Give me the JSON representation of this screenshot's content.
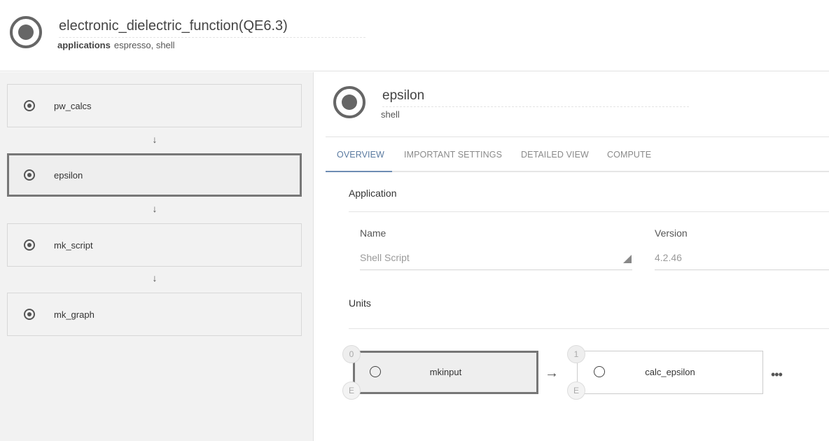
{
  "workflow": {
    "title": "electronic_dielectric_function(QE6.3)",
    "applications_label": "applications",
    "applications_value": "espresso, shell",
    "icon": "radio-filled-icon"
  },
  "sidebar": {
    "subworkflows": [
      {
        "label": "pw_calcs",
        "selected": false
      },
      {
        "label": "epsilon",
        "selected": true
      },
      {
        "label": "mk_script",
        "selected": false
      },
      {
        "label": "mk_graph",
        "selected": false
      }
    ],
    "arrow_glyph": "↓"
  },
  "unit": {
    "title": "epsilon",
    "subtitle": "shell"
  },
  "tabs": [
    {
      "label": "OVERVIEW",
      "active": true
    },
    {
      "label": "IMPORTANT SETTINGS",
      "active": false
    },
    {
      "label": "DETAILED VIEW",
      "active": false
    },
    {
      "label": "COMPUTE",
      "active": false
    }
  ],
  "application_section": {
    "title": "Application",
    "name_label": "Name",
    "name_value": "Shell Script",
    "version_label": "Version",
    "version_value": "4.2.46"
  },
  "units_section": {
    "title": "Units",
    "flow_arrow": "→",
    "more": "•••",
    "units": [
      {
        "index": "0",
        "name": "mkinput",
        "badge_e": "E",
        "selected": true
      },
      {
        "index": "1",
        "name": "calc_epsilon",
        "badge_e": "E",
        "selected": false
      }
    ]
  },
  "colors": {
    "accent": "#5a7aa0",
    "sidebar_bg": "#f2f2f2",
    "selected_border": "#777777"
  }
}
